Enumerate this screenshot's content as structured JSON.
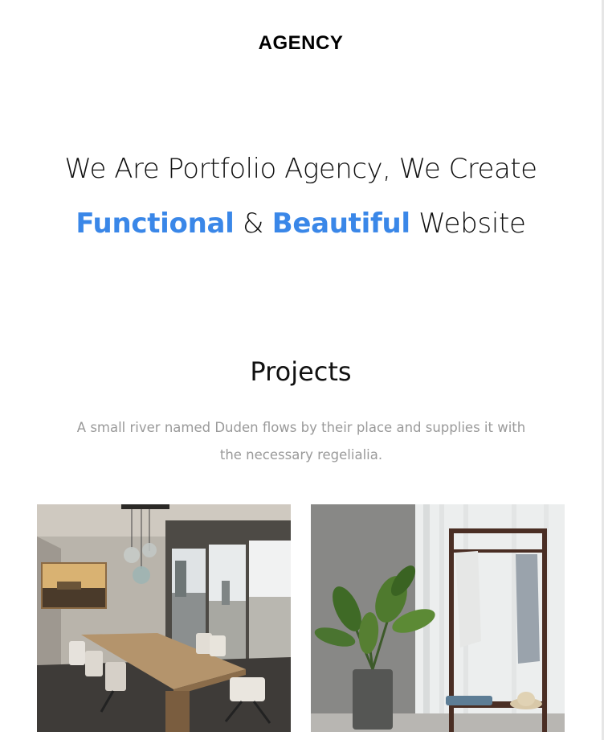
{
  "header": {
    "brand": "AGENCY"
  },
  "hero": {
    "line1": "We Are Portfolio Agency, We Create",
    "highlight1": "Functional",
    "amp": "&",
    "highlight2": "Beautiful",
    "word": "Website"
  },
  "projects": {
    "title": "Projects",
    "description": "A small river named Duden flows by their place and supplies it with the necessary regelialia.",
    "items": [
      {
        "image": "conference-room-photo"
      },
      {
        "image": "plant-and-clothes-rack-photo"
      }
    ]
  },
  "colors": {
    "accent": "#3a87e8",
    "muted_text": "#9a9a9a"
  }
}
